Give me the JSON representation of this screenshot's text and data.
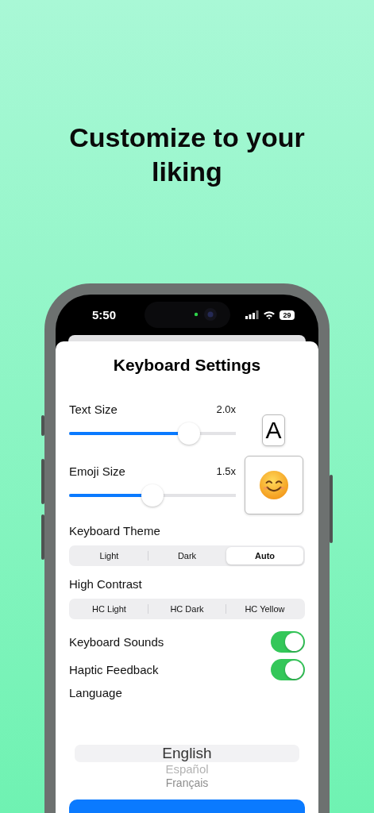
{
  "headline": "Customize to your liking",
  "status_bar": {
    "time": "5:50",
    "battery": "29"
  },
  "sheet": {
    "title": "Keyboard Settings",
    "sliders": [
      {
        "label": "Text Size",
        "reading": "2.0x",
        "level": 0.72,
        "preview": {
          "kind": "letter",
          "text": "A"
        }
      },
      {
        "label": "Emoji Size",
        "reading": "1.5x",
        "level": 0.5,
        "preview": {
          "kind": "emoji"
        }
      }
    ],
    "segment_groups": [
      {
        "label": "Keyboard Theme",
        "options": [
          {
            "label": "Light",
            "selected": false
          },
          {
            "label": "Dark",
            "selected": false
          },
          {
            "label": "Auto",
            "selected": true
          }
        ]
      },
      {
        "label": "High Contrast",
        "options": [
          {
            "label": "HC Light",
            "selected": false
          },
          {
            "label": "HC Dark",
            "selected": false
          },
          {
            "label": "HC Yellow",
            "selected": false
          }
        ]
      }
    ],
    "toggles": [
      {
        "label": "Keyboard Sounds",
        "on": true
      },
      {
        "label": "Haptic Feedback",
        "on": true
      }
    ],
    "language": {
      "label": "Language",
      "options": [
        {
          "label": "English",
          "selected": true
        },
        {
          "label": "Español",
          "selected": false
        },
        {
          "label": "Français",
          "selected": false
        }
      ]
    }
  }
}
